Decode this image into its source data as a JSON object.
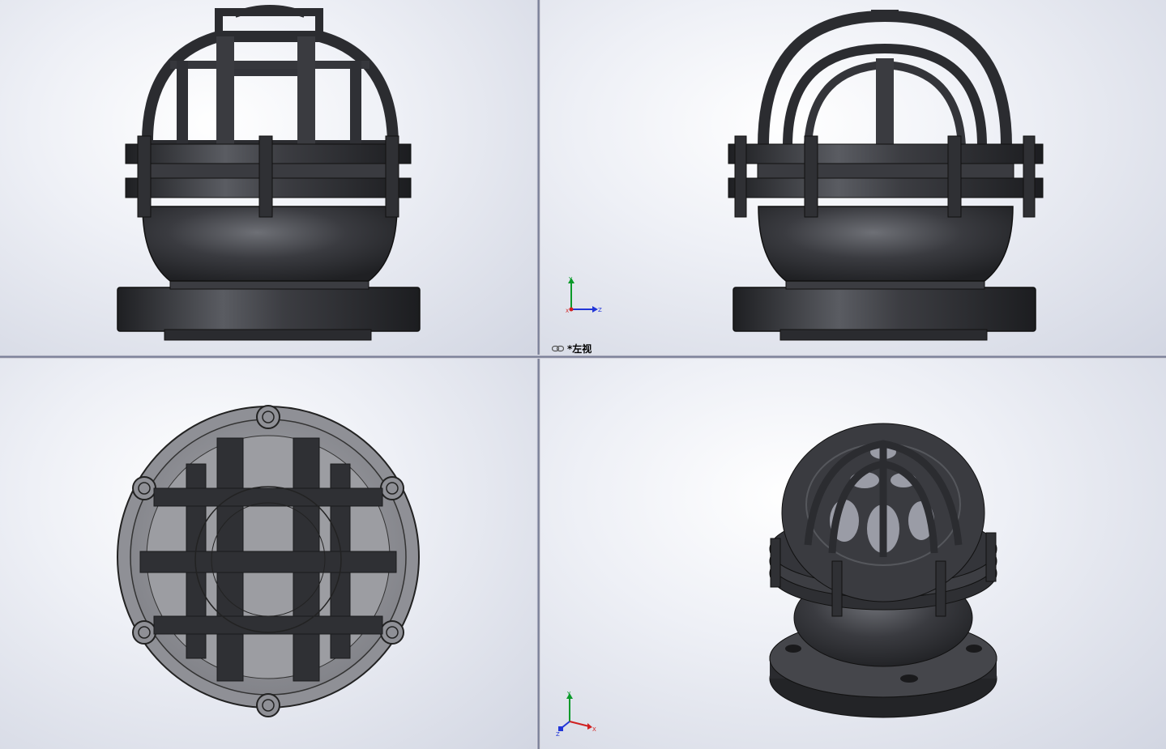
{
  "viewports": {
    "left_view": {
      "label": "*左视",
      "triad": {
        "up": "Y",
        "right": "Z",
        "origin": "X"
      }
    },
    "isometric": {
      "triad": {
        "up": "Y",
        "right": "X",
        "origin": "Z"
      }
    }
  },
  "icons": {
    "view_link": "link-icon",
    "triad": "coordinate-triad-icon"
  },
  "colors": {
    "model_dark": "#2e2f33",
    "model_light": "#8a8c93",
    "top_view_fill": "#8f9096",
    "axis_y": "#0a9a2a",
    "axis_z": "#2236d8",
    "axis_x": "#d02020",
    "divider": "#7b8098"
  }
}
